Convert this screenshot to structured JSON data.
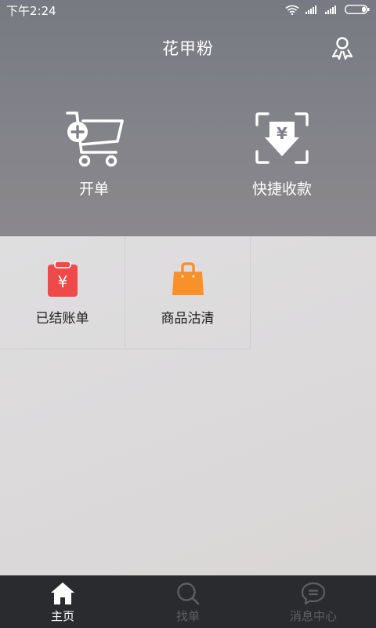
{
  "status_bar": {
    "time": "下午2:24"
  },
  "header": {
    "title": "花甲粉"
  },
  "actions": [
    {
      "label": "开单",
      "icon": "add-to-cart-icon"
    },
    {
      "label": "快捷收款",
      "icon": "scan-payment-icon"
    }
  ],
  "grid": [
    {
      "label": "已结账单",
      "icon": "red-yuan-bill-icon",
      "color": "#ee4a4a"
    },
    {
      "label": "商品沽清",
      "icon": "orange-shopping-bag-icon",
      "color": "#f9902a"
    }
  ],
  "bottom_nav": [
    {
      "label": "主页",
      "icon": "home-icon",
      "active": true
    },
    {
      "label": "找单",
      "icon": "search-icon",
      "active": false
    },
    {
      "label": "消息中心",
      "icon": "message-bubble-icon",
      "active": false
    }
  ],
  "colors": {
    "header_bg": "#7e7f86",
    "nav_bg": "#2a2b2f",
    "nav_inactive": "#5e5f63",
    "accent_red": "#ee4a4a",
    "accent_orange": "#f9902a"
  }
}
